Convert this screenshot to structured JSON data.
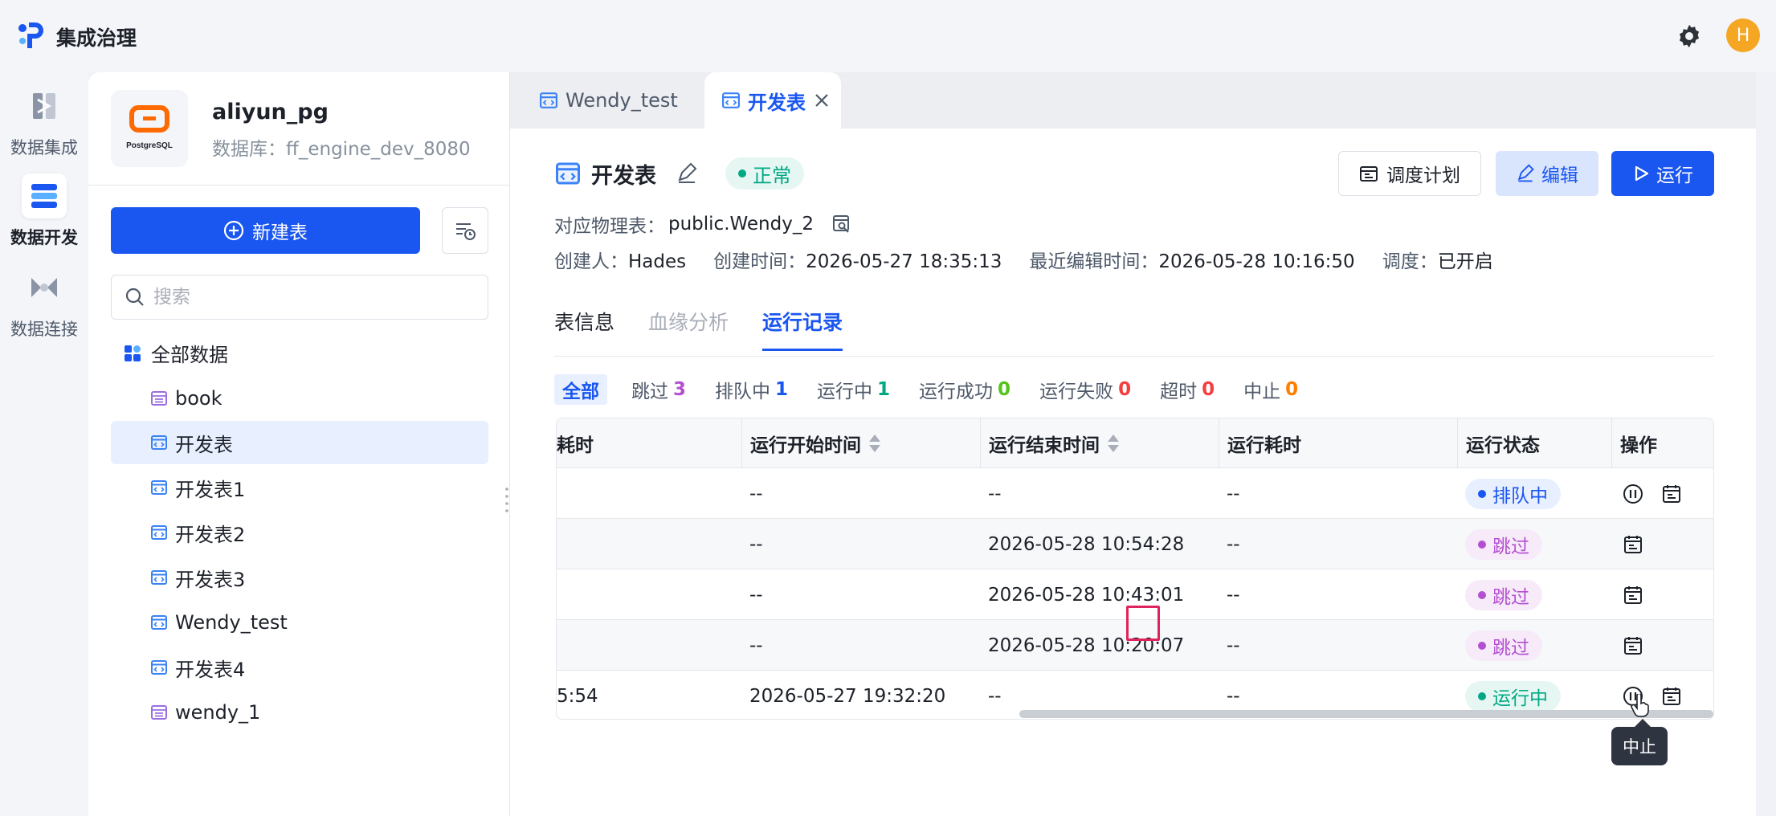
{
  "app": {
    "title": "集成治理",
    "avatar_letter": "H"
  },
  "rail": [
    {
      "label": "数据集成",
      "icon": "data-integration-icon"
    },
    {
      "label": "数据开发",
      "icon": "data-dev-icon",
      "active": true
    },
    {
      "label": "数据连接",
      "icon": "data-connect-icon"
    }
  ],
  "datasource": {
    "logo_text": "PostgreSQL",
    "name": "aliyun_pg",
    "database_label": "数据库：ff_engine_dev_8080"
  },
  "side": {
    "new_button": "新建表",
    "search_placeholder": "搜索",
    "tree_root": "全部数据",
    "items": [
      {
        "label": "book",
        "type": "table"
      },
      {
        "label": "开发表",
        "type": "dev",
        "selected": true
      },
      {
        "label": "开发表1",
        "type": "dev"
      },
      {
        "label": "开发表2",
        "type": "dev"
      },
      {
        "label": "开发表3",
        "type": "dev"
      },
      {
        "label": "Wendy_test",
        "type": "dev"
      },
      {
        "label": "开发表4",
        "type": "dev"
      },
      {
        "label": "wendy_1",
        "type": "table"
      }
    ]
  },
  "tabs": [
    {
      "label": "Wendy_test",
      "active": false
    },
    {
      "label": "开发表",
      "active": true
    }
  ],
  "detail": {
    "title": "开发表",
    "status": "正常",
    "buttons": {
      "schedule": "调度计划",
      "edit": "编辑",
      "run": "运行"
    },
    "physical_label": "对应物理表：",
    "physical_value": "public.Wendy_2",
    "creator_label": "创建人：",
    "creator_value": "Hades",
    "created_label": "创建时间：",
    "created_value": "2026-05-27 18:35:13",
    "edited_label": "最近编辑时间：",
    "edited_value": "2026-05-28 10:16:50",
    "sched_label": "调度：",
    "sched_value": "已开启"
  },
  "subtabs": [
    {
      "label": "表信息",
      "state": "normal"
    },
    {
      "label": "血缘分析",
      "state": "disabled"
    },
    {
      "label": "运行记录",
      "state": "active"
    }
  ],
  "filters": [
    {
      "label": "全部",
      "count": "",
      "color": "#1a56f0",
      "active": true
    },
    {
      "label": "跳过",
      "count": "3",
      "color": "#b44fd1"
    },
    {
      "label": "排队中",
      "count": "1",
      "color": "#1a56f0"
    },
    {
      "label": "运行中",
      "count": "1",
      "color": "#00a884"
    },
    {
      "label": "运行成功",
      "count": "0",
      "color": "#52c41a"
    },
    {
      "label": "运行失败",
      "count": "0",
      "color": "#f53f3f"
    },
    {
      "label": "超时",
      "count": "0",
      "color": "#f53f3f"
    },
    {
      "label": "中止",
      "count": "0",
      "color": "#ff7d00"
    }
  ],
  "table": {
    "columns": [
      "耗时",
      "运行开始时间",
      "运行结束时间",
      "运行耗时",
      "运行状态",
      "操作"
    ],
    "rows": [
      {
        "c0": "",
        "start": "--",
        "end": "--",
        "dur": "--",
        "status": "排队中",
        "status_kind": "queue",
        "ops": [
          "pause",
          "log"
        ]
      },
      {
        "c0": "",
        "start": "--",
        "end": "2026-05-28 10:54:28",
        "dur": "--",
        "status": "跳过",
        "status_kind": "skip",
        "ops": [
          "log"
        ]
      },
      {
        "c0": "",
        "start": "--",
        "end": "2026-05-28 10:43:01",
        "dur": "--",
        "status": "跳过",
        "status_kind": "skip",
        "ops": [
          "log"
        ]
      },
      {
        "c0": "",
        "start": "--",
        "end": "2026-05-28 10:20:07",
        "dur": "--",
        "status": "跳过",
        "status_kind": "skip",
        "ops": [
          "log"
        ]
      },
      {
        "c0": "5:54",
        "start": "2026-05-27 19:32:20",
        "end": "--",
        "dur": "--",
        "status": "运行中",
        "status_kind": "running",
        "ops": [
          "pause",
          "log"
        ]
      }
    ]
  },
  "tooltip": "中止"
}
